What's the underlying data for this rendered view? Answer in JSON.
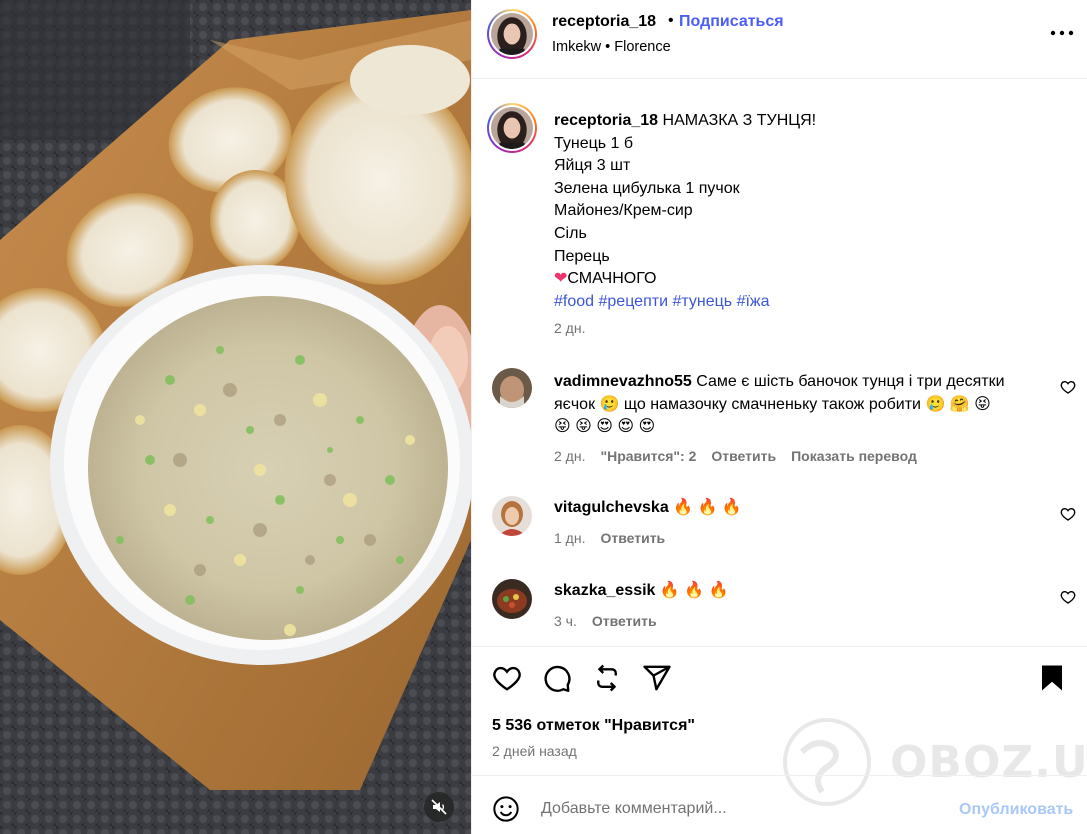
{
  "header": {
    "username": "receptoria_18",
    "separator": "•",
    "follow_label": "Подписаться",
    "location": "Imkekw • Florence",
    "more_icon": "more-horizontal-icon"
  },
  "caption": {
    "username": "receptoria_18",
    "title": "НАМАЗКА З ТУНЦЯ!",
    "lines": [
      "Тунець 1 б",
      "Яйця 3 шт",
      "Зелена цибулька 1 пучок",
      "Майонез/Крем-сир",
      "Сіль",
      "Перець"
    ],
    "heart_emoji": "❤",
    "closing": "СМАЧНОГО",
    "hashtags": [
      "#food",
      "#рецепти",
      "#тунець",
      "#їжа"
    ],
    "time": "2 дн."
  },
  "comments": [
    {
      "username": "vadimnevazhno55",
      "text_line1": "Саме є шість баночок тунця і три десятки",
      "text_line2": "яєчок 🥲  що намазочку смачненьку також робити 🥲 🤗 😝",
      "text_line3": "😝 😝 😍 😍 😍",
      "time": "2 дн.",
      "likes": "\"Нравится\": 2",
      "reply": "Ответить",
      "translate": "Показать перевод"
    },
    {
      "username": "vitagulchevska",
      "text": "🔥 🔥 🔥",
      "time": "1 дн.",
      "reply": "Ответить"
    },
    {
      "username": "skazka_essik",
      "text": "🔥 🔥 🔥",
      "time": "3 ч.",
      "reply": "Ответить"
    }
  ],
  "actions": {
    "like_icon": "heart-icon",
    "comment_icon": "comment-icon",
    "repost_icon": "repost-icon",
    "share_icon": "share-icon",
    "save_icon": "bookmark-icon",
    "likes_count": "5 536 отметок \"Нравится\"",
    "post_time": "2 дней назад"
  },
  "add_comment": {
    "placeholder": "Добавьте комментарий...",
    "publish_label": "Опубликовать"
  },
  "watermark": {
    "text": "OBOZ.UA"
  },
  "colors": {
    "link_blue": "#4a5df9",
    "hashtag_blue": "#3b56d8",
    "publish_disabled": "#a8c8f8",
    "secondary_text": "#737373",
    "divider": "#efefef"
  }
}
